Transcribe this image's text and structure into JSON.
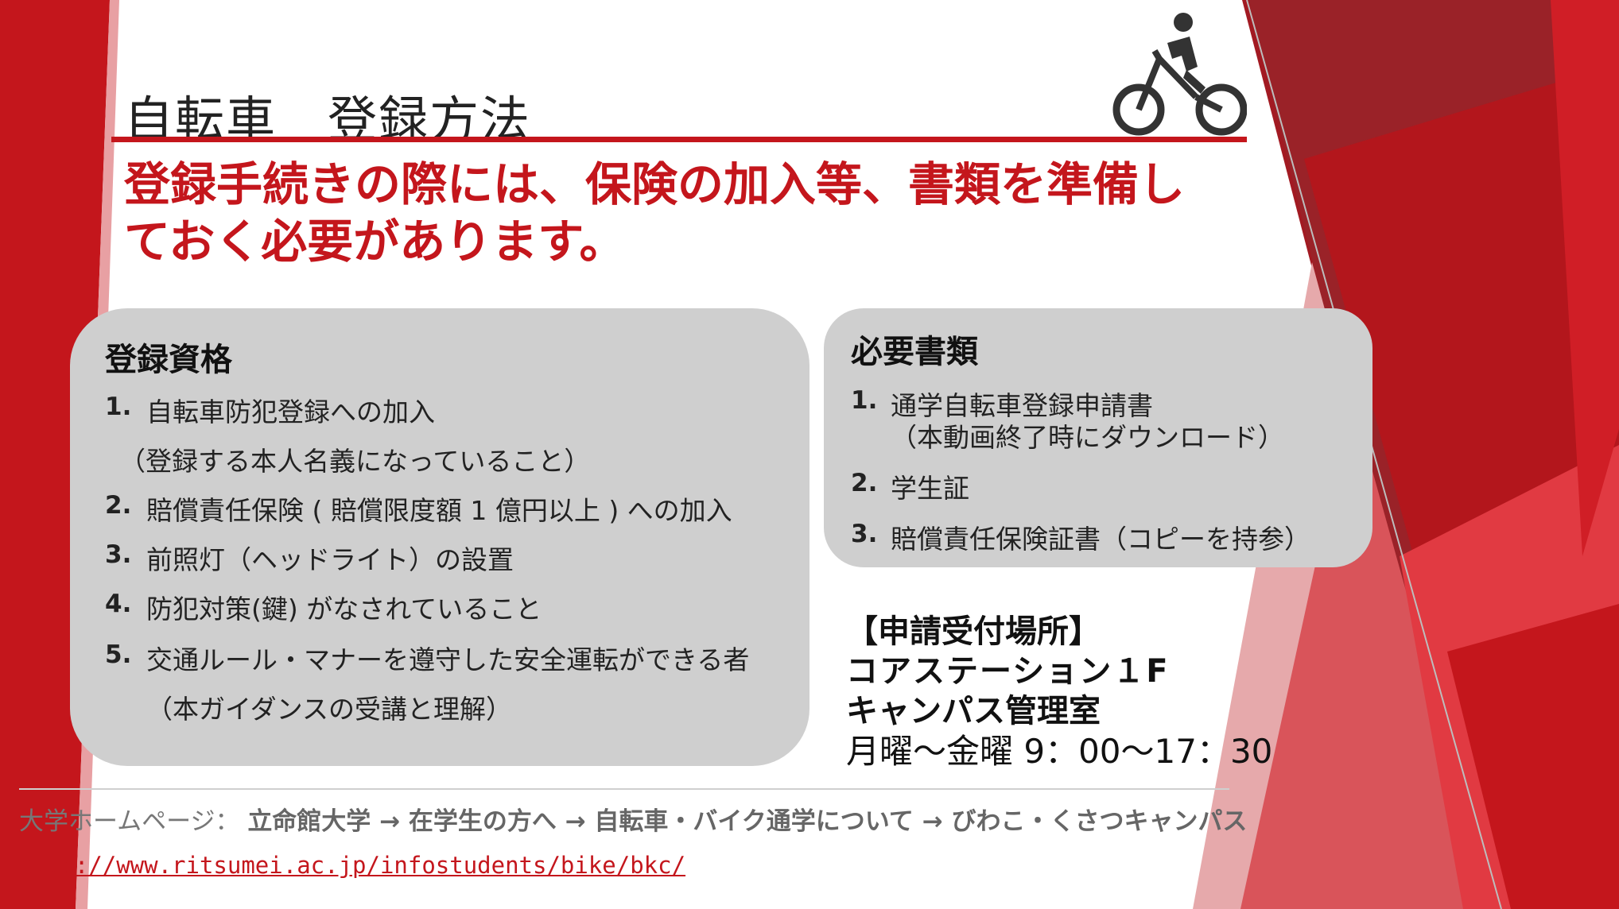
{
  "title": "自転車　登録方法",
  "headline": {
    "line1": "登録手続きの際には、保険の加入等、書類を準備し",
    "line2": "ておく必要があります。"
  },
  "eligibility": {
    "heading": "登録資格",
    "items": [
      {
        "num": "1.",
        "text": "自転車防犯登録への加入",
        "sub": "（登録する本人名義になっていること）"
      },
      {
        "num": "2.",
        "text": "賠償責任保険 ( 賠償限度額 1 億円以上 ) への加入"
      },
      {
        "num": "3.",
        "text": "前照灯（ヘッドライト）の設置"
      },
      {
        "num": "4.",
        "text": "防犯対策(鍵) がなされていること"
      },
      {
        "num": "5.",
        "text": "交通ルール・マナーを遵守した安全運転ができる者",
        "sub": "（本ガイダンスの受講と理解）"
      }
    ]
  },
  "documents": {
    "heading": "必要書類",
    "items": [
      {
        "num": "1.",
        "text": "通学自転車登録申請書",
        "sub": "（本動画終了時にダウンロード）"
      },
      {
        "num": "2.",
        "text": "学生証"
      },
      {
        "num": "3.",
        "text": "賠償責任保険証書（コピーを持参）"
      }
    ]
  },
  "office": {
    "label": "【申請受付場所】",
    "building": "コアステーション１F",
    "room": "キャンパス管理室",
    "hours": "月曜～金曜 9：00～17：30"
  },
  "footer": {
    "crumb_label": "大学ホームページ：",
    "crumb_path": "立命館大学 → 在学生の方へ → 自転車・バイク通学について → びわこ・くさつキャンパス",
    "url": "http://www.ritsumei.ac.jp/infostudents/bike/bkc/"
  },
  "colors": {
    "accent": "#c4161c",
    "box": "#cfcfcf"
  },
  "icons": [
    "bicycle-rider-icon"
  ]
}
